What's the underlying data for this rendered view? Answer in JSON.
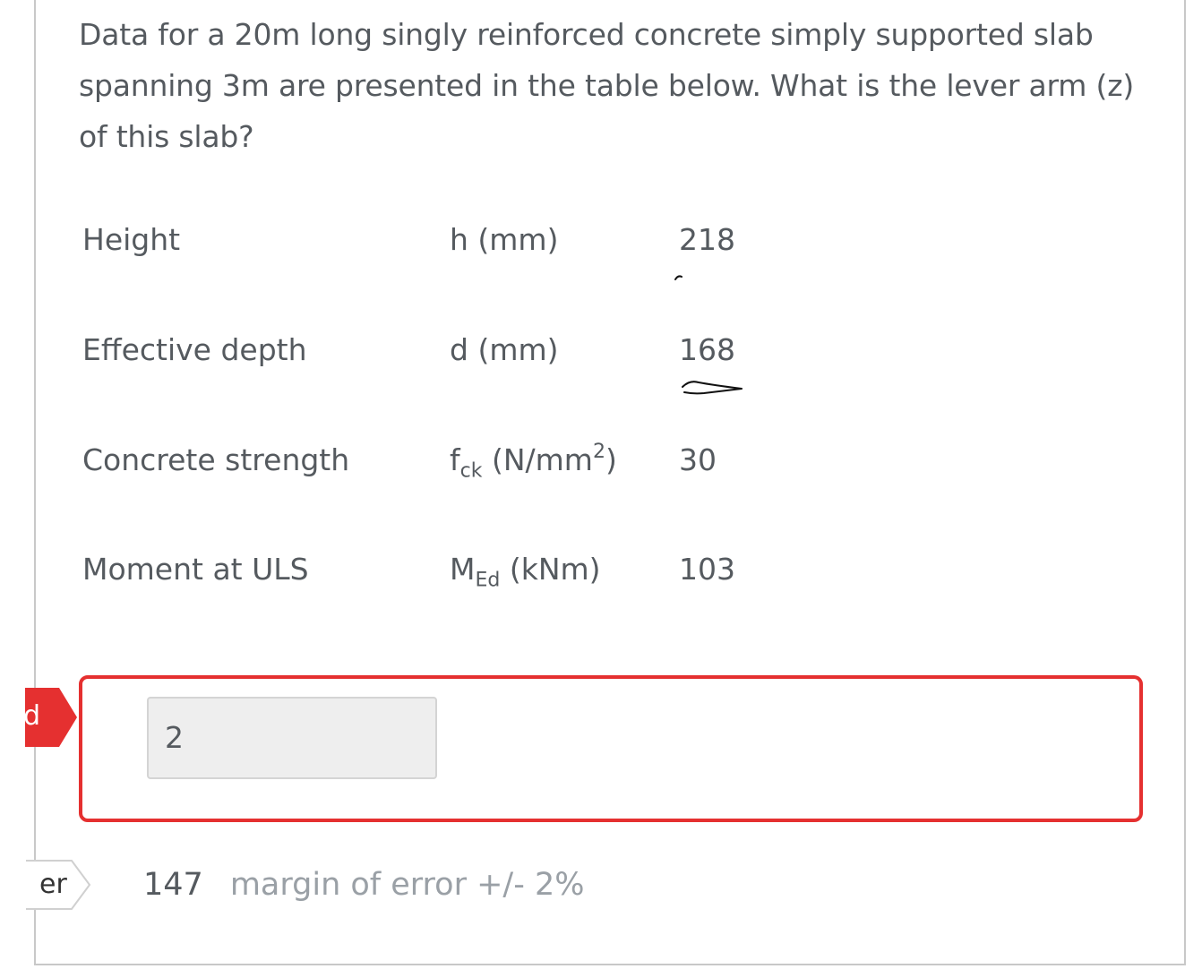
{
  "question": {
    "text": "Data for a 20m long singly reinforced concrete simply supported slab spanning 3m are presented in the table below. What is the lever arm (z) of this slab?"
  },
  "table": {
    "rows": [
      {
        "label": "Height",
        "symbol_main": "h",
        "symbol_sub": "",
        "unit": " (mm)",
        "unit_sup": "",
        "unit_close": "",
        "value": "218"
      },
      {
        "label": "Effective depth",
        "symbol_main": "d",
        "symbol_sub": "",
        "unit": " (mm)",
        "unit_sup": "",
        "unit_close": "",
        "value": "168"
      },
      {
        "label": "Concrete strength",
        "symbol_main": "f",
        "symbol_sub": "ck",
        "unit": " (N/mm",
        "unit_sup": "2",
        "unit_close": ")",
        "value": "30"
      },
      {
        "label": "Moment at ULS",
        "symbol_main": "M",
        "symbol_sub": "Ed",
        "unit": " (kNm)",
        "unit_sup": "",
        "unit_close": "",
        "value": "103"
      }
    ]
  },
  "side_tabs": {
    "status_label": "d",
    "answer_label": "er",
    "status_color": "#e53030"
  },
  "answer": {
    "input_value": "2",
    "border_color": "#e53030"
  },
  "correct": {
    "value": "147",
    "margin_text": "margin of error +/- 2%"
  }
}
